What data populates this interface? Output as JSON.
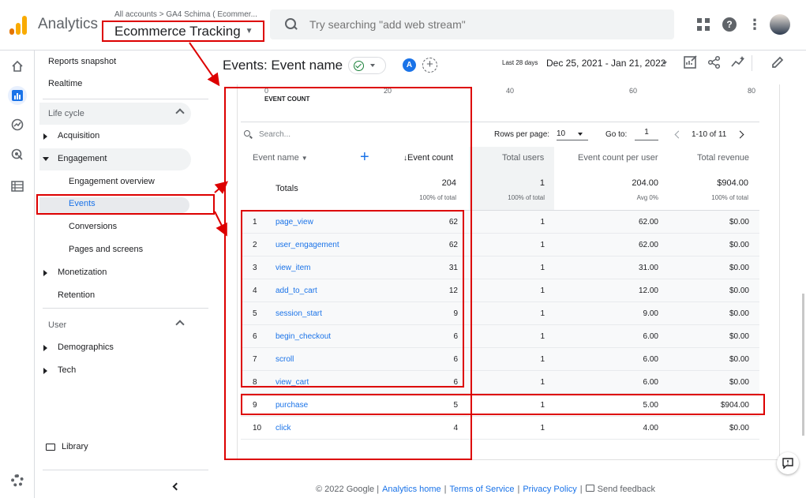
{
  "app": {
    "name": "Analytics",
    "breadcrumb": "All accounts > GA4 Schima ( Ecommer...",
    "property": "Ecommerce Tracking"
  },
  "search": {
    "placeholder": "Try searching \"add web stream\""
  },
  "nav": {
    "reports_snapshot": "Reports snapshot",
    "realtime": "Realtime",
    "lifecycle": "Life cycle",
    "acquisition": "Acquisition",
    "engagement": "Engagement",
    "engagement_overview": "Engagement overview",
    "events": "Events",
    "conversions": "Conversions",
    "pages_and_screens": "Pages and screens",
    "monetization": "Monetization",
    "retention": "Retention",
    "user": "User",
    "demographics": "Demographics",
    "tech": "Tech",
    "library": "Library"
  },
  "header": {
    "title": "Events: Event name",
    "compare_letter": "A",
    "date_label": "Last 28 days",
    "date_range": "Dec 25, 2021 - Jan 21, 2022"
  },
  "chart_axis": {
    "ticks": [
      "0",
      "20",
      "40",
      "60",
      "80"
    ],
    "title": "EVENT COUNT"
  },
  "table_controls": {
    "search_placeholder": "Search...",
    "rows_per_page_label": "Rows per page:",
    "rows_per_page": "10",
    "goto_label": "Go to:",
    "goto_value": "1",
    "pager": "1-10 of 11"
  },
  "columns": {
    "event_name": "Event name",
    "event_count": "Event count",
    "total_users": "Total users",
    "event_count_per_user": "Event count per user",
    "total_revenue": "Total revenue"
  },
  "totals": {
    "label": "Totals",
    "event_count": "204",
    "event_count_sub": "100% of total",
    "total_users": "1",
    "total_users_sub": "100% of total",
    "per_user": "204.00",
    "per_user_sub": "Avg 0%",
    "revenue": "$904.00",
    "revenue_sub": "100% of total"
  },
  "rows": [
    {
      "idx": "1",
      "name": "page_view",
      "count": "62",
      "users": "1",
      "per_user": "62.00",
      "revenue": "$0.00"
    },
    {
      "idx": "2",
      "name": "user_engagement",
      "count": "62",
      "users": "1",
      "per_user": "62.00",
      "revenue": "$0.00"
    },
    {
      "idx": "3",
      "name": "view_item",
      "count": "31",
      "users": "1",
      "per_user": "31.00",
      "revenue": "$0.00"
    },
    {
      "idx": "4",
      "name": "add_to_cart",
      "count": "12",
      "users": "1",
      "per_user": "12.00",
      "revenue": "$0.00"
    },
    {
      "idx": "5",
      "name": "session_start",
      "count": "9",
      "users": "1",
      "per_user": "9.00",
      "revenue": "$0.00"
    },
    {
      "idx": "6",
      "name": "begin_checkout",
      "count": "6",
      "users": "1",
      "per_user": "6.00",
      "revenue": "$0.00"
    },
    {
      "idx": "7",
      "name": "scroll",
      "count": "6",
      "users": "1",
      "per_user": "6.00",
      "revenue": "$0.00"
    },
    {
      "idx": "8",
      "name": "view_cart",
      "count": "6",
      "users": "1",
      "per_user": "6.00",
      "revenue": "$0.00"
    },
    {
      "idx": "9",
      "name": "purchase",
      "count": "5",
      "users": "1",
      "per_user": "5.00",
      "revenue": "$904.00"
    },
    {
      "idx": "10",
      "name": "click",
      "count": "4",
      "users": "1",
      "per_user": "4.00",
      "revenue": "$0.00"
    }
  ],
  "footer": {
    "copyright": "© 2022 Google |",
    "analytics_home": "Analytics home",
    "terms": "Terms of Service",
    "privacy": "Privacy Policy",
    "feedback": "Send feedback"
  },
  "colors": {
    "accent": "#1a73e8",
    "annotation": "#dd0000",
    "logo_orange": "#f9ab00",
    "logo_dark": "#e37400"
  }
}
